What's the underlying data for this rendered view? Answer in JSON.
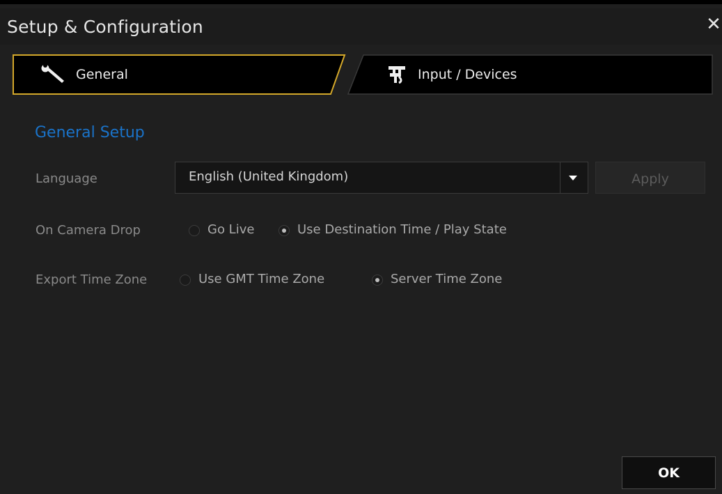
{
  "window": {
    "title": "Setup & Configuration",
    "close_glyph": "✕"
  },
  "tabs": [
    {
      "label": "General",
      "icon": "wrench-icon",
      "active": true
    },
    {
      "label": "Input / Devices",
      "icon": "camera-mount-icon",
      "active": false
    }
  ],
  "section": {
    "title": "General Setup"
  },
  "language": {
    "label": "Language",
    "selected": "English (United Kingdom)",
    "apply_label": "Apply"
  },
  "camera_drop": {
    "label": "On Camera Drop",
    "options": [
      {
        "label": "Go Live",
        "checked": false
      },
      {
        "label": "Use Destination Time / Play State",
        "checked": true
      }
    ]
  },
  "export_time_zone": {
    "label": "Export Time Zone",
    "options": [
      {
        "label": "Use GMT Time Zone",
        "checked": false
      },
      {
        "label": "Server Time Zone",
        "checked": true
      }
    ]
  },
  "footer": {
    "ok_label": "OK"
  },
  "colors": {
    "accent_gold": "#d4a82a",
    "section_blue": "#1a73c9",
    "background": "#1f1f1f"
  }
}
